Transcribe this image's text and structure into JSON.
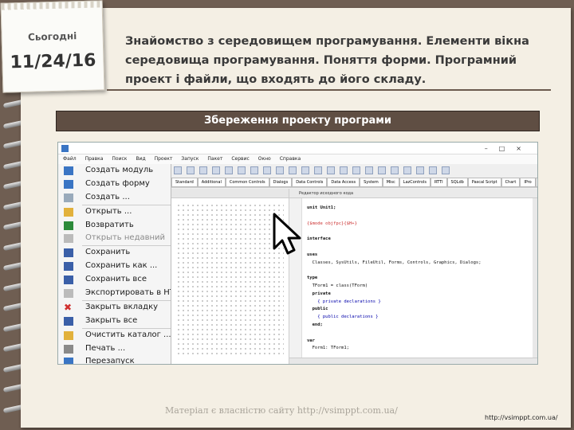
{
  "note": {
    "today_label": "Сьогодні",
    "date": "11/24/16"
  },
  "header": {
    "title": "Знайомство з середовищем програмування. Елементи вікна середовища програмування. Поняття форми. Програмний проект і файли, що входять до його складу."
  },
  "section_bar": {
    "label": "Збереження проекту програми"
  },
  "ide": {
    "menu_bar": [
      "Файл",
      "Правка",
      "Поиск",
      "Вид",
      "Проект",
      "Запуск",
      "Пакет",
      "Сервис",
      "Окно",
      "Справка"
    ],
    "component_tabs": [
      "Standard",
      "Additional",
      "Common Controls",
      "Dialogs",
      "Data Controls",
      "Data Access",
      "System",
      "Misc",
      "LazControls",
      "RTTI",
      "SQLdb",
      "Pascal Script",
      "Chart",
      "IPro",
      "SynEdit"
    ],
    "file_menu": [
      {
        "label": "Создать модуль",
        "icon": "new-unit-icon",
        "color": "#3a75c4",
        "disabled": false
      },
      {
        "label": "Создать форму",
        "icon": "new-form-icon",
        "color": "#3a75c4",
        "disabled": false
      },
      {
        "label": "Создать ...",
        "icon": "new-icon",
        "color": "#9ab",
        "disabled": false
      },
      {
        "label": "Открыть ...",
        "icon": "open-folder-icon",
        "color": "#e2b13c",
        "disabled": false
      },
      {
        "label": "Возвратить",
        "icon": "revert-icon",
        "color": "#2c8a3a",
        "disabled": false
      },
      {
        "label": "Открыть недавний",
        "icon": "recent-icon",
        "color": "#bbb",
        "disabled": true
      },
      {
        "label": "Сохранить",
        "icon": "save-icon",
        "color": "#3a5fa8",
        "disabled": false
      },
      {
        "label": "Сохранить как ...",
        "icon": "save-as-icon",
        "color": "#3a5fa8",
        "disabled": false
      },
      {
        "label": "Сохранить все",
        "icon": "save-all-icon",
        "color": "#3a5fa8",
        "disabled": false
      },
      {
        "label": "Экспортировать в HTML",
        "icon": "export-icon",
        "color": "#bbb",
        "disabled": false
      },
      {
        "label": "Закрыть вкладку",
        "icon": "close-tab-icon",
        "color": "#d03030",
        "disabled": false
      },
      {
        "label": "Закрыть все",
        "icon": "close-all-icon",
        "color": "#3a5fa8",
        "disabled": false
      },
      {
        "label": "Очистить каталог ...",
        "icon": "clean-dir-icon",
        "color": "#e2b13c",
        "disabled": false
      },
      {
        "label": "Печать ...",
        "icon": "print-icon",
        "color": "#8a8a8a",
        "disabled": false
      },
      {
        "label": "Перезапуск",
        "icon": "restart-icon",
        "color": "#3a75c4",
        "disabled": false
      }
    ],
    "editor_title": "Редактор исходного кода",
    "code_lines": [
      "unit Unit1;",
      "",
      "{$mode objfpc}{$H+}",
      "",
      "interface",
      "",
      "uses",
      "  Classes, SysUtils, FileUtil, Forms, Controls, Graphics, Dialogs;",
      "",
      "type",
      "  TForm1 = class(TForm)",
      "  private",
      "    { private declarations }",
      "  public",
      "    { public declarations }",
      "  end;",
      "",
      "var",
      "  Form1: TForm1;",
      "",
      "implementation",
      ""
    ]
  },
  "footer": {
    "watermark": "Матеріал є власністю сайту http://vsimppt.com.ua/",
    "site": "http://vsimppt.com.ua/"
  }
}
